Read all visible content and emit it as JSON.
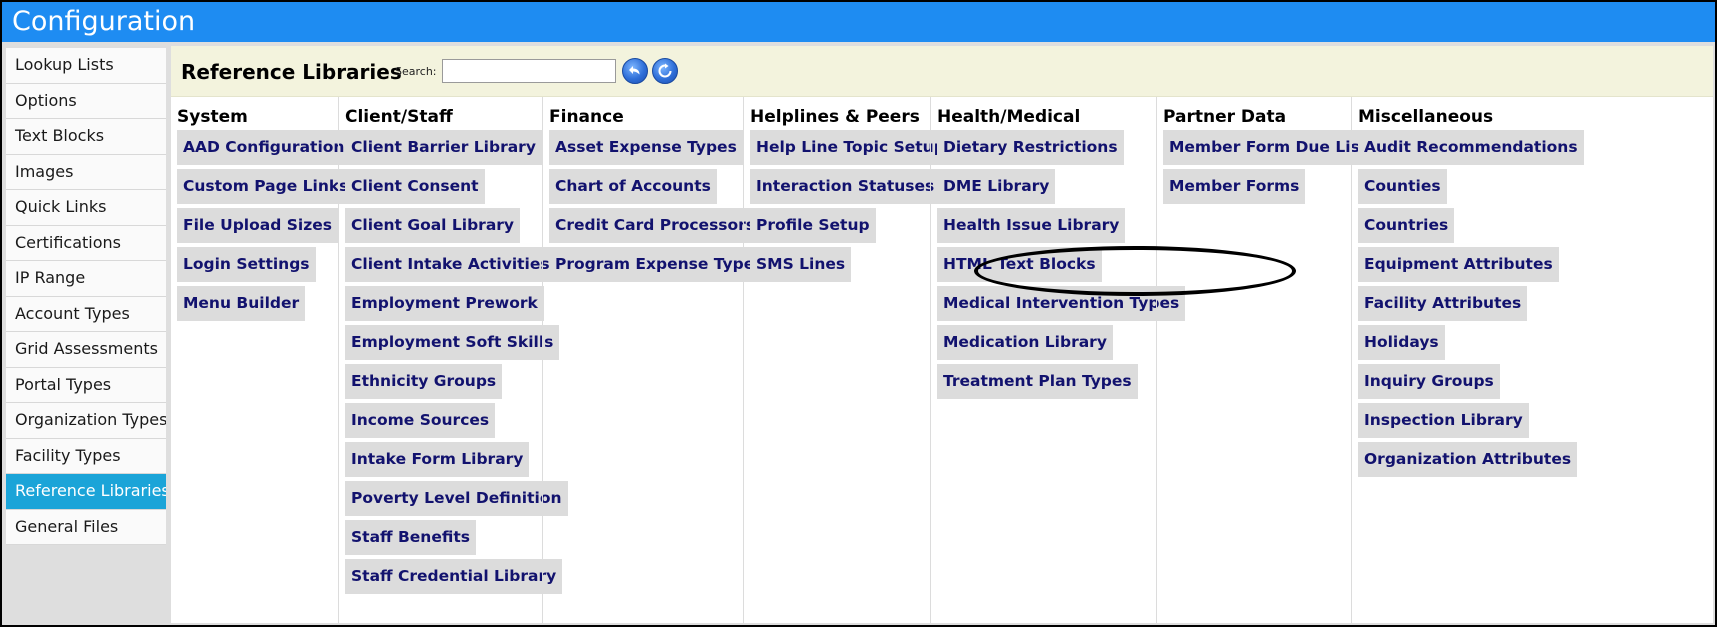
{
  "window": {
    "title": "Configuration"
  },
  "sidebar": {
    "items": [
      {
        "label": "Lookup Lists"
      },
      {
        "label": "Options"
      },
      {
        "label": "Text Blocks"
      },
      {
        "label": "Images"
      },
      {
        "label": "Quick Links"
      },
      {
        "label": "Certifications"
      },
      {
        "label": "IP Range"
      },
      {
        "label": "Account Types"
      },
      {
        "label": "Grid Assessments"
      },
      {
        "label": "Portal Types"
      },
      {
        "label": "Organization Types"
      },
      {
        "label": "Facility Types"
      },
      {
        "label": "Reference Libraries",
        "active": true
      },
      {
        "label": "General Files"
      }
    ]
  },
  "header": {
    "title": "Reference Libraries",
    "search_label": "Search:",
    "search_value": "",
    "back_icon": "undo-arrow-icon",
    "refresh_icon": "refresh-icon",
    "accent_color": "#1e8cf2"
  },
  "columns": [
    {
      "title": "System",
      "items": [
        "AAD Configuration",
        "Custom Page Links",
        "File Upload Sizes",
        "Login Settings",
        "Menu Builder"
      ]
    },
    {
      "title": "Client/Staff",
      "items": [
        "Client Barrier Library",
        "Client Consent",
        "Client Goal Library",
        "Client Intake Activities",
        "Employment Prework",
        "Employment Soft Skills",
        "Ethnicity Groups",
        "Income Sources",
        "Intake Form Library",
        "Poverty Level Definition",
        "Staff Benefits",
        "Staff Credential Library"
      ]
    },
    {
      "title": "Finance",
      "items": [
        "Asset Expense Types",
        "Chart of Accounts",
        "Credit Card Processors",
        "Program Expense Types"
      ]
    },
    {
      "title": "Helplines & Peers",
      "items": [
        "Help Line Topic Setup",
        "Interaction Statuses",
        "Profile Setup",
        "SMS Lines"
      ]
    },
    {
      "title": "Health/Medical",
      "items": [
        "Dietary Restrictions",
        "DME Library",
        "Health Issue Library",
        "HTML Text Blocks",
        "Medical Intervention Types",
        "Medication Library",
        "Treatment Plan Types"
      ]
    },
    {
      "title": "Partner Data",
      "items": [
        "Member Form Due List",
        "Member Forms"
      ]
    },
    {
      "title": "Miscellaneous",
      "items": [
        "Audit Recommendations",
        "Counties",
        "Countries",
        "Equipment Attributes",
        "Facility Attributes",
        "Holidays",
        "Inquiry Groups",
        "Inspection Library",
        "Organization Attributes"
      ]
    }
  ]
}
